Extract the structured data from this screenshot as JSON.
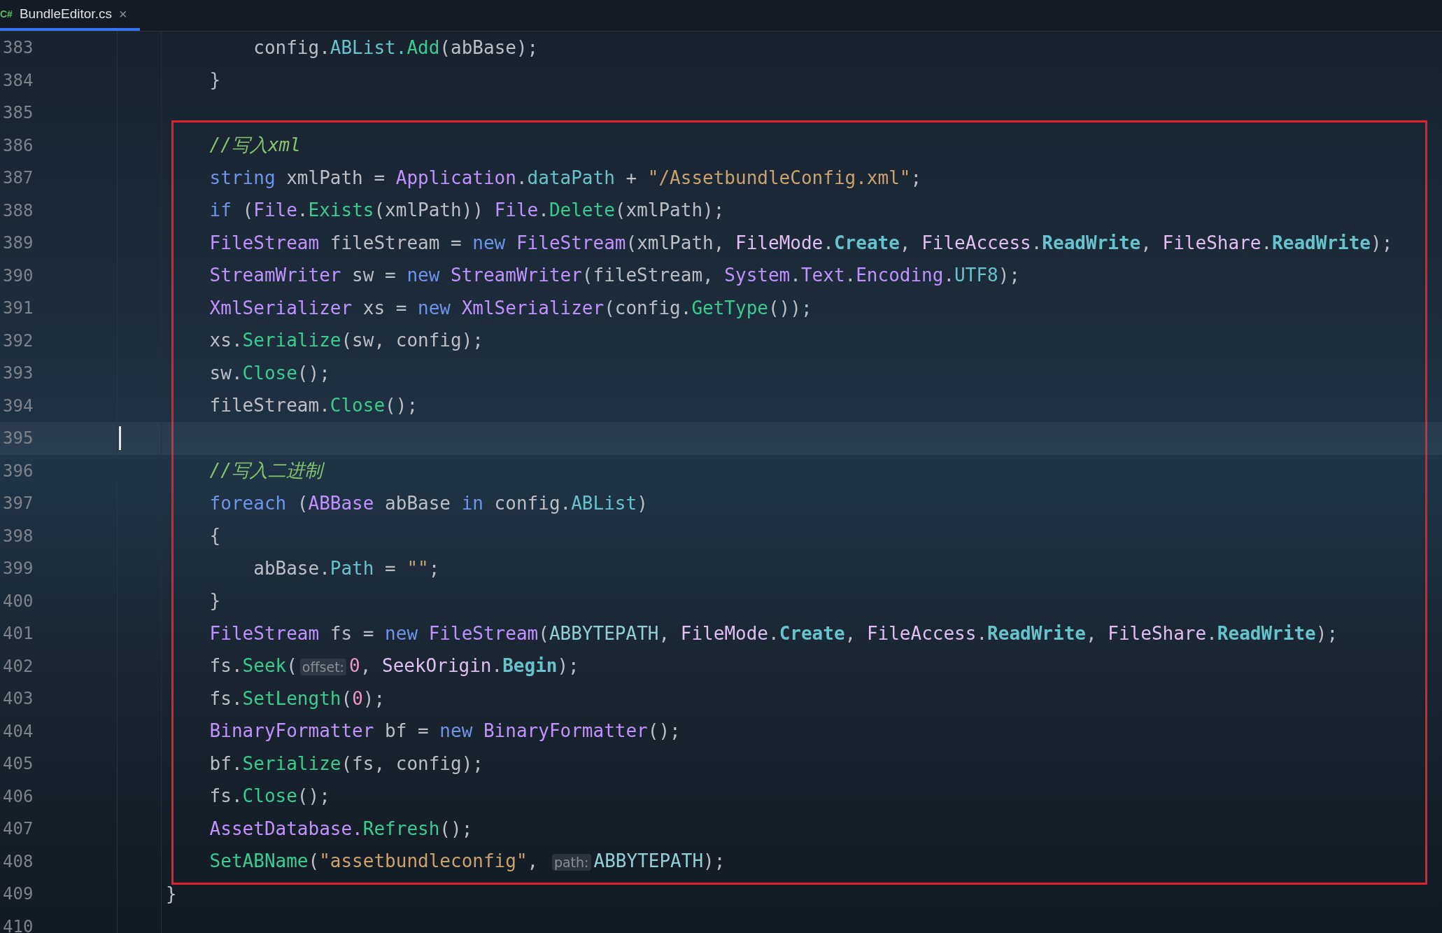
{
  "tabs": [
    {
      "icon_text": "C#",
      "label": "BundleEditor.cs",
      "close": "×",
      "selected": true
    }
  ],
  "blocks": [
    {
      "highlighted": false,
      "lines": [
        {
          "number": "383",
          "current": false,
          "tokens": [
            {
              "text": "        config.",
              "kind": "plain"
            },
            {
              "text": "ABList.",
              "kind": "property"
            },
            {
              "text": "Add",
              "kind": "method"
            },
            {
              "text": "(abBase);",
              "kind": "plain"
            }
          ]
        },
        {
          "number": "384",
          "current": false,
          "tokens": [
            {
              "text": "    }",
              "kind": "plain"
            }
          ]
        },
        {
          "number": "385",
          "current": false
        }
      ]
    },
    {
      "highlighted": true,
      "lines": [
        {
          "number": "386",
          "current": false,
          "tokens": [
            {
              "text": "    //写入xml",
              "kind": "comment"
            }
          ]
        },
        {
          "number": "387",
          "current": false,
          "tokens": [
            {
              "text": "    string",
              "kind": "keyword"
            },
            {
              "text": " xmlPath = ",
              "kind": "plain"
            },
            {
              "text": "Application",
              "kind": "type"
            },
            {
              "text": ".",
              "kind": "plain"
            },
            {
              "text": "dataPath",
              "kind": "property"
            },
            {
              "text": " + ",
              "kind": "plain"
            },
            {
              "text": "\"/AssetbundleConfig.xml\"",
              "kind": "string"
            },
            {
              "text": ";",
              "kind": "plain"
            }
          ]
        },
        {
          "number": "388",
          "current": false,
          "tokens": [
            {
              "text": "    if",
              "kind": "keyword"
            },
            {
              "text": " (",
              "kind": "plain"
            },
            {
              "text": "File",
              "kind": "type"
            },
            {
              "text": ".",
              "kind": "plain"
            },
            {
              "text": "Exists",
              "kind": "method"
            },
            {
              "text": "(xmlPath)) ",
              "kind": "plain"
            },
            {
              "text": "File",
              "kind": "type"
            },
            {
              "text": ".",
              "kind": "plain"
            },
            {
              "text": "Delete",
              "kind": "method"
            },
            {
              "text": "(xmlPath);",
              "kind": "plain"
            }
          ]
        },
        {
          "number": "389",
          "current": false,
          "tokens": [
            {
              "text": "    FileStream",
              "kind": "type"
            },
            {
              "text": " fileStream = ",
              "kind": "plain"
            },
            {
              "text": "new ",
              "kind": "keyword"
            },
            {
              "text": "FileStream",
              "kind": "type"
            },
            {
              "text": "(xmlPath, ",
              "kind": "plain"
            },
            {
              "text": "FileMode",
              "kind": "enum"
            },
            {
              "text": ".",
              "kind": "plain"
            },
            {
              "text": "Create",
              "kind": "member"
            },
            {
              "text": ", ",
              "kind": "plain"
            },
            {
              "text": "FileAccess",
              "kind": "enum"
            },
            {
              "text": ".",
              "kind": "plain"
            },
            {
              "text": "ReadWrite",
              "kind": "member"
            },
            {
              "text": ", ",
              "kind": "plain"
            },
            {
              "text": "FileShare",
              "kind": "enum"
            },
            {
              "text": ".",
              "kind": "plain"
            },
            {
              "text": "ReadWrite",
              "kind": "member"
            },
            {
              "text": ");",
              "kind": "plain"
            }
          ]
        },
        {
          "number": "390",
          "current": false,
          "tokens": [
            {
              "text": "    StreamWriter",
              "kind": "type"
            },
            {
              "text": " sw = ",
              "kind": "plain"
            },
            {
              "text": "new ",
              "kind": "keyword"
            },
            {
              "text": "StreamWriter",
              "kind": "type"
            },
            {
              "text": "(fileStream, ",
              "kind": "plain"
            },
            {
              "text": "System",
              "kind": "type"
            },
            {
              "text": ".",
              "kind": "plain"
            },
            {
              "text": "Text",
              "kind": "type"
            },
            {
              "text": ".",
              "kind": "plain"
            },
            {
              "text": "Encoding",
              "kind": "type"
            },
            {
              "text": ".",
              "kind": "plain"
            },
            {
              "text": "UTF8",
              "kind": "property"
            },
            {
              "text": ");",
              "kind": "plain"
            }
          ]
        },
        {
          "number": "391",
          "current": false,
          "tokens": [
            {
              "text": "    XmlSerializer",
              "kind": "type"
            },
            {
              "text": " xs = ",
              "kind": "plain"
            },
            {
              "text": "new ",
              "kind": "keyword"
            },
            {
              "text": "XmlSerializer",
              "kind": "type"
            },
            {
              "text": "(config.",
              "kind": "plain"
            },
            {
              "text": "GetType",
              "kind": "method"
            },
            {
              "text": "());",
              "kind": "plain"
            }
          ]
        },
        {
          "number": "392",
          "current": false,
          "tokens": [
            {
              "text": "    xs.",
              "kind": "plain"
            },
            {
              "text": "Serialize",
              "kind": "method"
            },
            {
              "text": "(sw, config);",
              "kind": "plain"
            }
          ]
        },
        {
          "number": "393",
          "current": false,
          "tokens": [
            {
              "text": "    sw.",
              "kind": "plain"
            },
            {
              "text": "Close",
              "kind": "method"
            },
            {
              "text": "();",
              "kind": "plain"
            }
          ]
        },
        {
          "number": "394",
          "current": false,
          "tokens": [
            {
              "text": "    fileStream.",
              "kind": "plain"
            },
            {
              "text": "Close",
              "kind": "method"
            },
            {
              "text": "();",
              "kind": "plain"
            }
          ]
        },
        {
          "number": "395",
          "current": true
        },
        {
          "number": "396",
          "current": false,
          "tokens": [
            {
              "text": "    //写入二进制",
              "kind": "comment"
            }
          ]
        },
        {
          "number": "397",
          "current": false,
          "tokens": [
            {
              "text": "    foreach",
              "kind": "keyword"
            },
            {
              "text": " (",
              "kind": "plain"
            },
            {
              "text": "ABBase",
              "kind": "type"
            },
            {
              "text": " abBase ",
              "kind": "plain"
            },
            {
              "text": "in",
              "kind": "keyword"
            },
            {
              "text": " config.",
              "kind": "plain"
            },
            {
              "text": "ABList",
              "kind": "property"
            },
            {
              "text": ")",
              "kind": "plain"
            }
          ]
        },
        {
          "number": "398",
          "current": false,
          "tokens": [
            {
              "text": "    {",
              "kind": "plain"
            }
          ]
        },
        {
          "number": "399",
          "current": false,
          "tokens": [
            {
              "text": "        abBase.",
              "kind": "plain"
            },
            {
              "text": "Path",
              "kind": "property"
            },
            {
              "text": " = ",
              "kind": "plain"
            },
            {
              "text": "\"\"",
              "kind": "string"
            },
            {
              "text": ";",
              "kind": "plain"
            }
          ]
        },
        {
          "number": "400",
          "current": false,
          "tokens": [
            {
              "text": "    }",
              "kind": "plain"
            }
          ]
        },
        {
          "number": "401",
          "current": false,
          "tokens": [
            {
              "text": "    FileStream",
              "kind": "type"
            },
            {
              "text": " fs = ",
              "kind": "plain"
            },
            {
              "text": "new ",
              "kind": "keyword"
            },
            {
              "text": "FileStream",
              "kind": "type"
            },
            {
              "text": "(",
              "kind": "plain"
            },
            {
              "text": "ABBYTEPATH",
              "kind": "constant"
            },
            {
              "text": ", ",
              "kind": "plain"
            },
            {
              "text": "FileMode",
              "kind": "enum"
            },
            {
              "text": ".",
              "kind": "plain"
            },
            {
              "text": "Create",
              "kind": "member"
            },
            {
              "text": ", ",
              "kind": "plain"
            },
            {
              "text": "FileAccess",
              "kind": "enum"
            },
            {
              "text": ".",
              "kind": "plain"
            },
            {
              "text": "ReadWrite",
              "kind": "member"
            },
            {
              "text": ", ",
              "kind": "plain"
            },
            {
              "text": "FileShare",
              "kind": "enum"
            },
            {
              "text": ".",
              "kind": "plain"
            },
            {
              "text": "ReadWrite",
              "kind": "member"
            },
            {
              "text": ");",
              "kind": "plain"
            }
          ]
        },
        {
          "number": "402",
          "current": false,
          "tokens": [
            {
              "text": "    fs.",
              "kind": "plain"
            },
            {
              "text": "Seek",
              "kind": "method"
            },
            {
              "text": "(",
              "kind": "plain"
            },
            {
              "text": "offset:",
              "kind": "hint"
            },
            {
              "text": "0",
              "kind": "number"
            },
            {
              "text": ", ",
              "kind": "plain"
            },
            {
              "text": "SeekOrigin",
              "kind": "enum"
            },
            {
              "text": ".",
              "kind": "plain"
            },
            {
              "text": "Begin",
              "kind": "member"
            },
            {
              "text": ");",
              "kind": "plain"
            }
          ]
        },
        {
          "number": "403",
          "current": false,
          "tokens": [
            {
              "text": "    fs.",
              "kind": "plain"
            },
            {
              "text": "SetLength",
              "kind": "method"
            },
            {
              "text": "(",
              "kind": "plain"
            },
            {
              "text": "0",
              "kind": "number"
            },
            {
              "text": ");",
              "kind": "plain"
            }
          ]
        },
        {
          "number": "404",
          "current": false,
          "tokens": [
            {
              "text": "    BinaryFormatter",
              "kind": "type"
            },
            {
              "text": " bf = ",
              "kind": "plain"
            },
            {
              "text": "new ",
              "kind": "keyword"
            },
            {
              "text": "BinaryFormatter",
              "kind": "type"
            },
            {
              "text": "();",
              "kind": "plain"
            }
          ]
        },
        {
          "number": "405",
          "current": false,
          "tokens": [
            {
              "text": "    bf.",
              "kind": "plain"
            },
            {
              "text": "Serialize",
              "kind": "method"
            },
            {
              "text": "(fs, config);",
              "kind": "plain"
            }
          ]
        },
        {
          "number": "406",
          "current": false,
          "tokens": [
            {
              "text": "    fs.",
              "kind": "plain"
            },
            {
              "text": "Close",
              "kind": "method"
            },
            {
              "text": "();",
              "kind": "plain"
            }
          ]
        },
        {
          "number": "407",
          "current": false,
          "tokens": [
            {
              "text": "    AssetDatabase.",
              "kind": "type"
            },
            {
              "text": "Refresh",
              "kind": "method"
            },
            {
              "text": "();",
              "kind": "plain"
            }
          ]
        },
        {
          "number": "408",
          "current": false,
          "tokens": [
            {
              "text": "    SetABName",
              "kind": "method"
            },
            {
              "text": "(",
              "kind": "plain"
            },
            {
              "text": "\"assetbundleconfig\"",
              "kind": "string"
            },
            {
              "text": ", ",
              "kind": "plain"
            },
            {
              "text": "path:",
              "kind": "hint"
            },
            {
              "text": "ABBYTEPATH",
              "kind": "constant"
            },
            {
              "text": ");",
              "kind": "plain"
            }
          ]
        }
      ]
    },
    {
      "highlighted": false,
      "lines": [
        {
          "number": "409",
          "current": false,
          "tokens": [
            {
              "text": "}",
              "kind": "plain"
            }
          ]
        },
        {
          "number": "410",
          "current": false
        }
      ]
    }
  ]
}
